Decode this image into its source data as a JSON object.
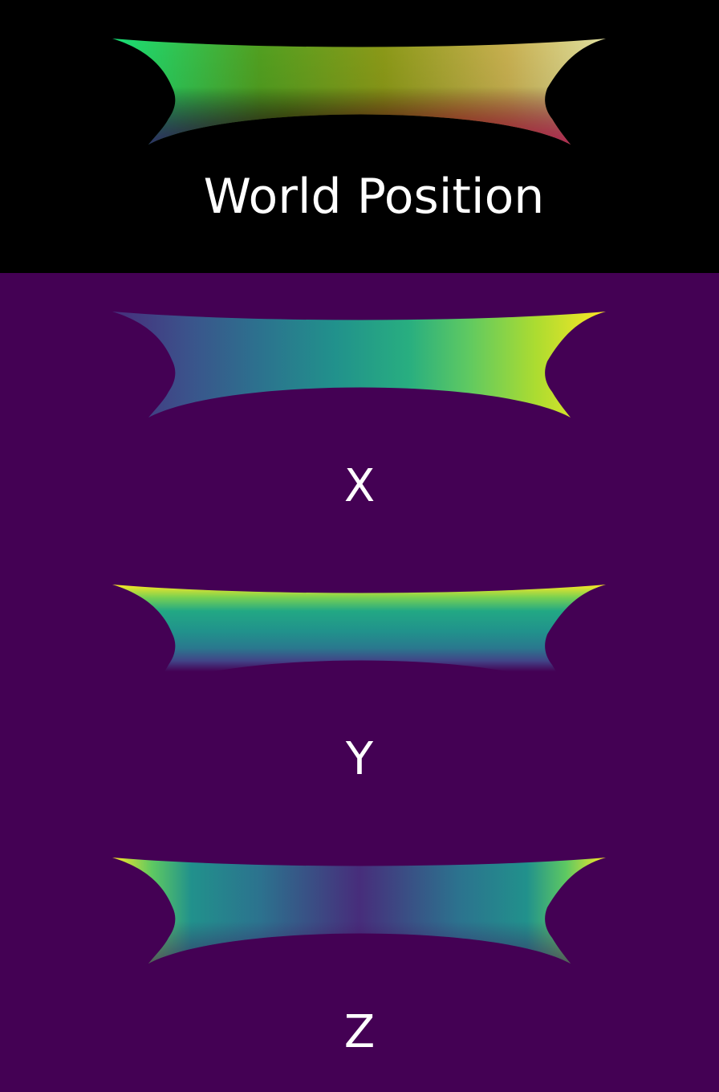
{
  "panels": {
    "world": {
      "label": "World Position",
      "background": "#000000"
    },
    "x": {
      "label": "X"
    },
    "y": {
      "label": "Y"
    },
    "z": {
      "label": "Z"
    }
  },
  "colors": {
    "viridis_background": "#440154",
    "label_text": "#ffffff"
  }
}
